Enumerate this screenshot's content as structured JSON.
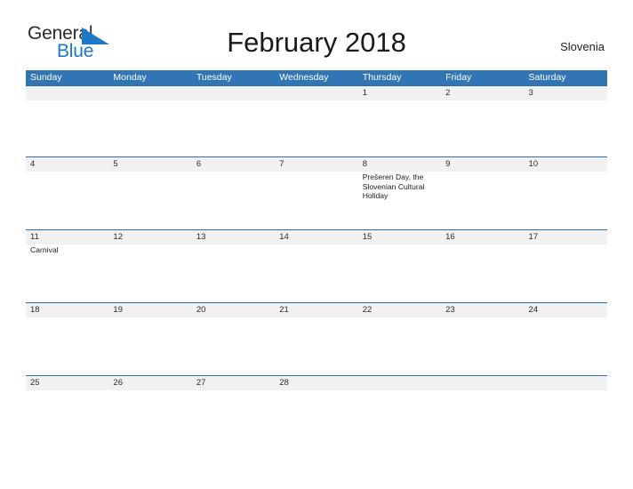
{
  "brand": {
    "name_part1": "General",
    "name_part2": "Blue",
    "flag_color": "#1b79c8"
  },
  "header": {
    "title": "February 2018",
    "region": "Slovenia"
  },
  "theme": {
    "header_blue": "#3175b5",
    "rule_blue": "#2e6ea8",
    "number_band": "#f1f1f1",
    "link_blue": "#1b79c8"
  },
  "calendar": {
    "month": "February",
    "year": "2018",
    "weekdays": [
      {
        "label": "Sunday"
      },
      {
        "label": "Monday"
      },
      {
        "label": "Tuesday"
      },
      {
        "label": "Wednesday"
      },
      {
        "label": "Thursday"
      },
      {
        "label": "Friday"
      },
      {
        "label": "Saturday"
      }
    ],
    "weeks": [
      {
        "days": [
          {
            "number": "",
            "event": ""
          },
          {
            "number": "",
            "event": ""
          },
          {
            "number": "",
            "event": ""
          },
          {
            "number": "",
            "event": ""
          },
          {
            "number": "1",
            "event": ""
          },
          {
            "number": "2",
            "event": ""
          },
          {
            "number": "3",
            "event": ""
          }
        ]
      },
      {
        "days": [
          {
            "number": "4",
            "event": ""
          },
          {
            "number": "5",
            "event": ""
          },
          {
            "number": "6",
            "event": ""
          },
          {
            "number": "7",
            "event": ""
          },
          {
            "number": "8",
            "event": "Prešeren Day, the Slovenian Cultural Holiday"
          },
          {
            "number": "9",
            "event": ""
          },
          {
            "number": "10",
            "event": ""
          }
        ]
      },
      {
        "days": [
          {
            "number": "11",
            "event": "Carnival"
          },
          {
            "number": "12",
            "event": ""
          },
          {
            "number": "13",
            "event": ""
          },
          {
            "number": "14",
            "event": ""
          },
          {
            "number": "15",
            "event": ""
          },
          {
            "number": "16",
            "event": ""
          },
          {
            "number": "17",
            "event": ""
          }
        ]
      },
      {
        "days": [
          {
            "number": "18",
            "event": ""
          },
          {
            "number": "19",
            "event": ""
          },
          {
            "number": "20",
            "event": ""
          },
          {
            "number": "21",
            "event": ""
          },
          {
            "number": "22",
            "event": ""
          },
          {
            "number": "23",
            "event": ""
          },
          {
            "number": "24",
            "event": ""
          }
        ]
      },
      {
        "days": [
          {
            "number": "25",
            "event": ""
          },
          {
            "number": "26",
            "event": ""
          },
          {
            "number": "27",
            "event": ""
          },
          {
            "number": "28",
            "event": ""
          },
          {
            "number": "",
            "event": ""
          },
          {
            "number": "",
            "event": ""
          },
          {
            "number": "",
            "event": ""
          }
        ]
      }
    ]
  }
}
